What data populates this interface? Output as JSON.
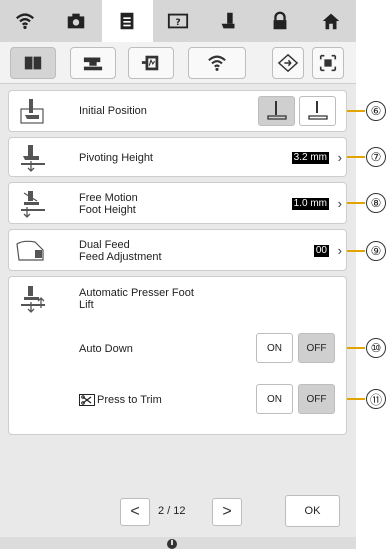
{
  "tabs": [
    {
      "icon": "wifi-icon"
    },
    {
      "icon": "camera-icon"
    },
    {
      "icon": "document-icon"
    },
    {
      "icon": "help-icon"
    },
    {
      "icon": "presser-foot-icon"
    },
    {
      "icon": "lock-icon"
    },
    {
      "icon": "home-icon"
    }
  ],
  "settings": {
    "initial_position": {
      "label": "Initial Position"
    },
    "pivoting_height": {
      "label": "Pivoting Height",
      "value": "3.2 mm"
    },
    "free_motion": {
      "label_line1": "Free Motion",
      "label_line2": "Foot Height",
      "value": "1.0 mm"
    },
    "dual_feed": {
      "label_line1": "Dual Feed",
      "label_line2": "Feed Adjustment",
      "value": "00"
    },
    "auto_lift": {
      "label_line1": "Automatic Presser Foot",
      "label_line2": "Lift"
    },
    "auto_down": {
      "label": "Auto Down",
      "on": "ON",
      "off": "OFF"
    },
    "press_trim": {
      "label": "Press to Trim",
      "on": "ON",
      "off": "OFF"
    }
  },
  "callouts": [
    "⑥",
    "⑦",
    "⑧",
    "⑨",
    "⑩",
    "⑪"
  ],
  "pager": {
    "text": "2 / 12",
    "prev": "<",
    "next": ">"
  },
  "ok_label": "OK",
  "colors": {
    "callout": "#e2a400",
    "selected": "#cfcfcf"
  }
}
